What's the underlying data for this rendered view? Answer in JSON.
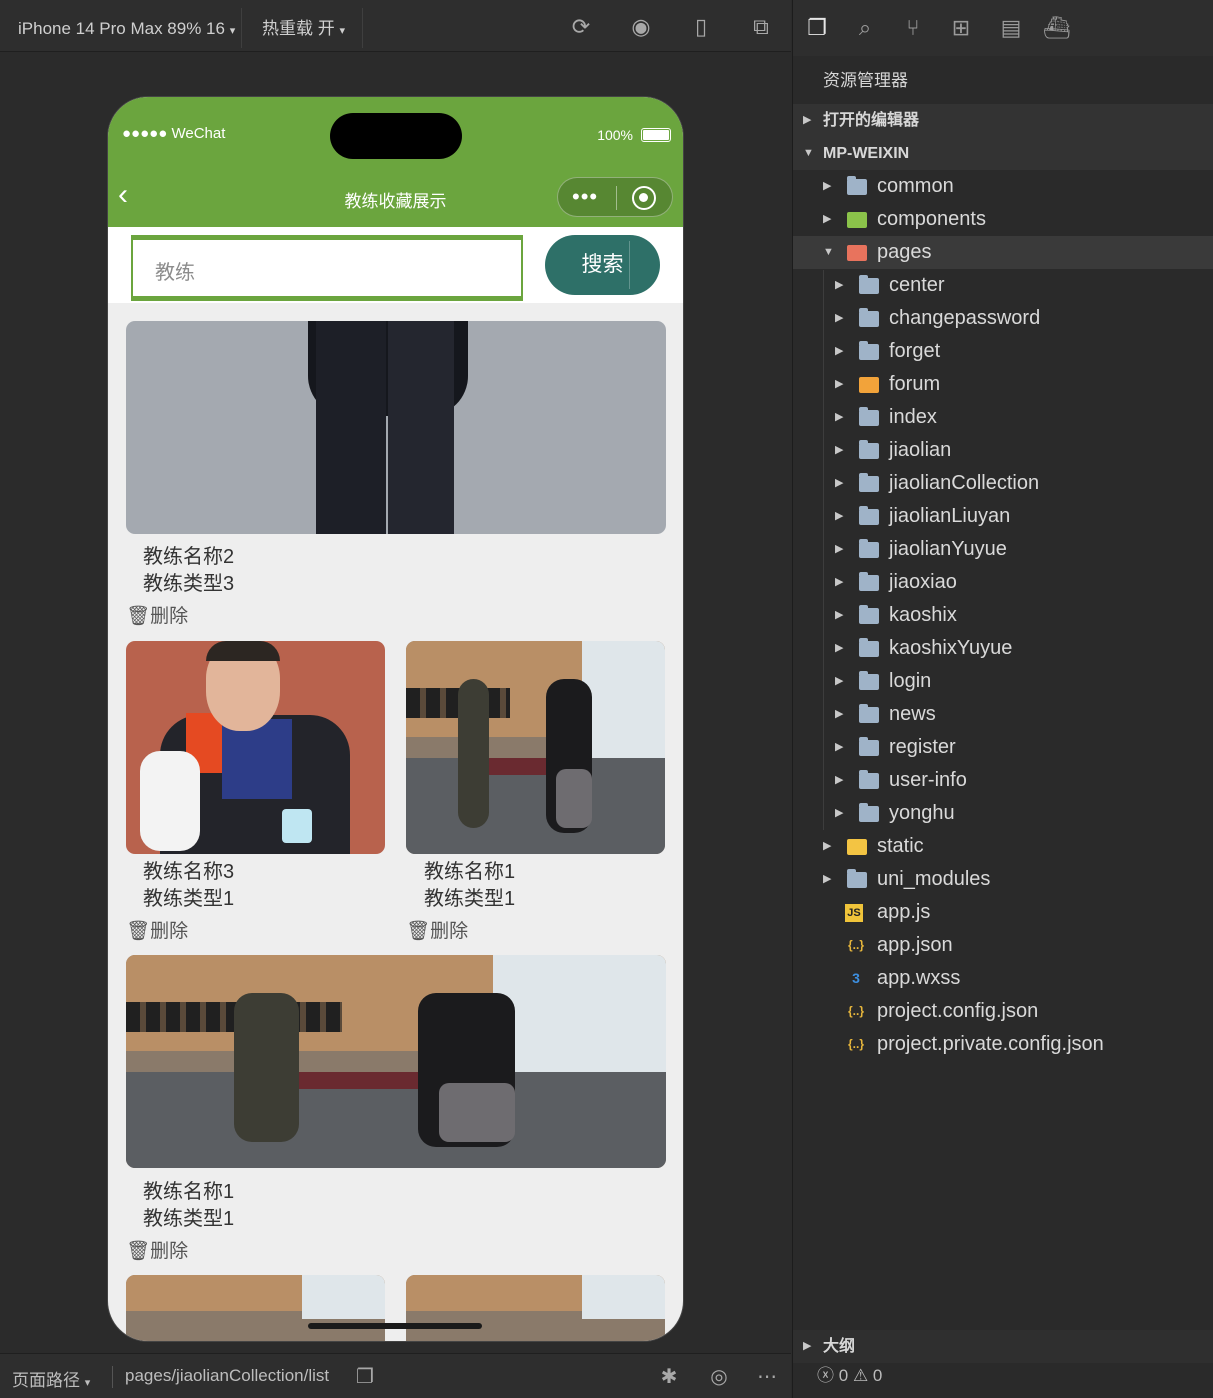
{
  "toolbar": {
    "device": "iPhone 14 Pro Max 89% 16",
    "hot_reload": "热重载 开",
    "icons": [
      "refresh-icon",
      "stop-icon",
      "phone-icon",
      "window-icon"
    ]
  },
  "phone": {
    "status": {
      "carrier": "●●●●● WeChat",
      "battery": "100%"
    },
    "nav_title": "教练收藏展示",
    "search": {
      "placeholder": "教练",
      "button": "搜索"
    },
    "cards": [
      {
        "name": "教练名称2",
        "type": "教练类型3",
        "delete": "删除",
        "image": "suit"
      },
      {
        "name": "教练名称3",
        "type": "教练类型1",
        "delete": "删除",
        "image": "portrait"
      },
      {
        "name": "教练名称1",
        "type": "教练类型1",
        "delete": "删除",
        "image": "gym"
      },
      {
        "name": "教练名称1",
        "type": "教练类型1",
        "delete": "删除",
        "image": "gym"
      }
    ]
  },
  "explorer": {
    "title": "资源管理器",
    "open_editors": "打开的编辑器",
    "project": "MP-WEIXIN",
    "items": [
      {
        "label": "common",
        "kind": "folder"
      },
      {
        "label": "components",
        "kind": "folder-green"
      },
      {
        "label": "pages",
        "kind": "folder-red",
        "expanded": true
      },
      {
        "label": "center",
        "kind": "folder"
      },
      {
        "label": "changepassword",
        "kind": "folder"
      },
      {
        "label": "forget",
        "kind": "folder"
      },
      {
        "label": "forum",
        "kind": "folder-orange"
      },
      {
        "label": "index",
        "kind": "folder"
      },
      {
        "label": "jiaolian",
        "kind": "folder"
      },
      {
        "label": "jiaolianCollection",
        "kind": "folder"
      },
      {
        "label": "jiaolianLiuyan",
        "kind": "folder"
      },
      {
        "label": "jiaolianYuyue",
        "kind": "folder"
      },
      {
        "label": "jiaoxiao",
        "kind": "folder"
      },
      {
        "label": "kaoshix",
        "kind": "folder"
      },
      {
        "label": "kaoshixYuyue",
        "kind": "folder"
      },
      {
        "label": "login",
        "kind": "folder"
      },
      {
        "label": "news",
        "kind": "folder"
      },
      {
        "label": "register",
        "kind": "folder"
      },
      {
        "label": "user-info",
        "kind": "folder"
      },
      {
        "label": "yonghu",
        "kind": "folder"
      },
      {
        "label": "static",
        "kind": "folder-yellow"
      },
      {
        "label": "uni_modules",
        "kind": "folder"
      },
      {
        "label": "app.js",
        "kind": "js"
      },
      {
        "label": "app.json",
        "kind": "json"
      },
      {
        "label": "app.wxss",
        "kind": "css"
      },
      {
        "label": "project.config.json",
        "kind": "json"
      },
      {
        "label": "project.private.config.json",
        "kind": "json"
      }
    ],
    "outline": "大纲",
    "errors": "0",
    "warnings": "0"
  },
  "bottombar": {
    "page_path_label": "页面路径",
    "page_path": "pages/jiaolianCollection/list"
  },
  "colors": {
    "brand_green": "#6ba53e",
    "search_button": "#2e7068"
  }
}
